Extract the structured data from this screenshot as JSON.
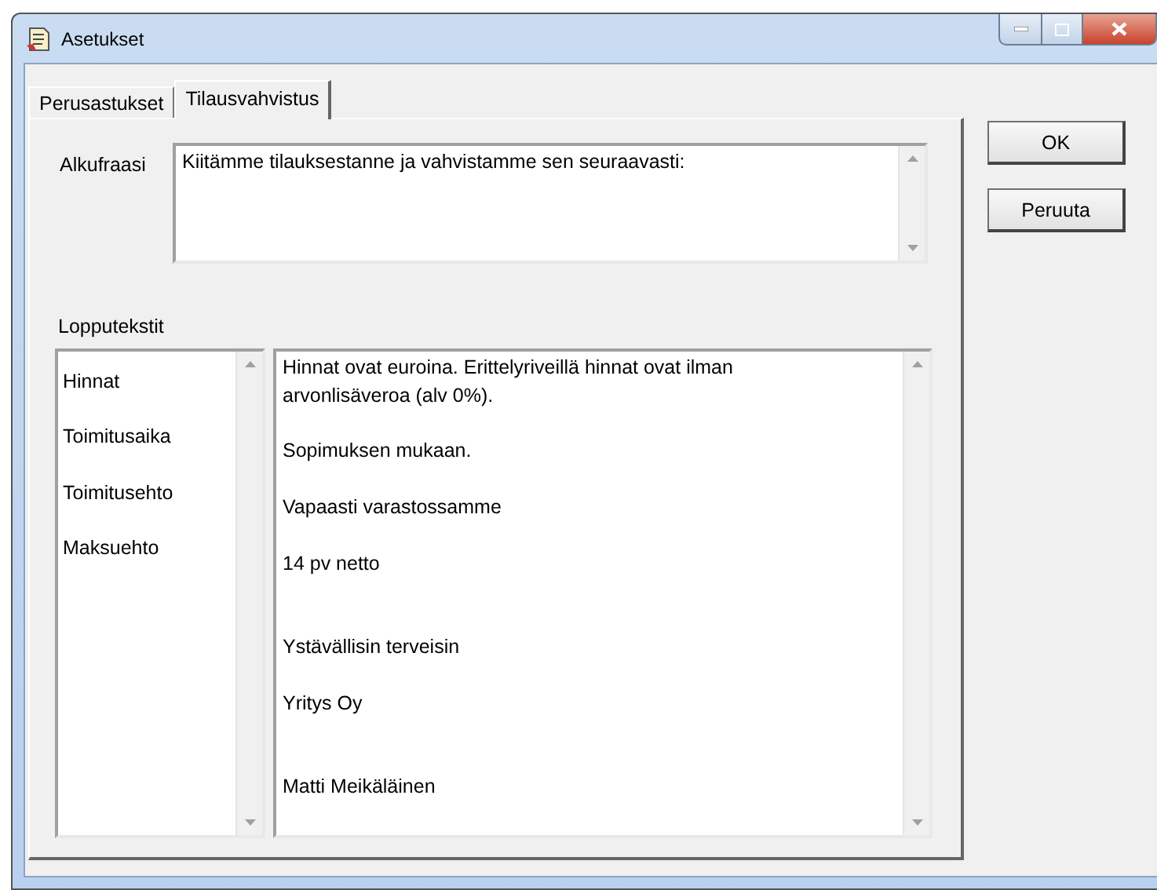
{
  "window": {
    "title": "Asetukset"
  },
  "tabs": [
    {
      "label": "Perusastukset",
      "selected": false
    },
    {
      "label": "Tilausvahvistus",
      "selected": true
    }
  ],
  "intro": {
    "label": "Alkufraasi",
    "value": "Kiitämme tilauksestanne ja vahvistamme sen seuraavasti:"
  },
  "closing_texts": {
    "label": "Lopputekstit",
    "items": [
      {
        "label": "Hinnat"
      },
      {
        "label": "Toimitusaika"
      },
      {
        "label": "Toimitusehto"
      },
      {
        "label": "Maksuehto"
      }
    ],
    "value": "Hinnat ovat euroina. Erittelyriveillä hinnat ovat ilman arvonlisäveroa (alv 0%).\n\nSopimuksen mukaan.\n\nVapaasti varastossamme\n\n14 pv netto\n\n\nYstävällisin terveisin\n\nYritys Oy\n\n\nMatti Meikäläinen"
  },
  "buttons": [
    "OK",
    "Peruuta"
  ]
}
